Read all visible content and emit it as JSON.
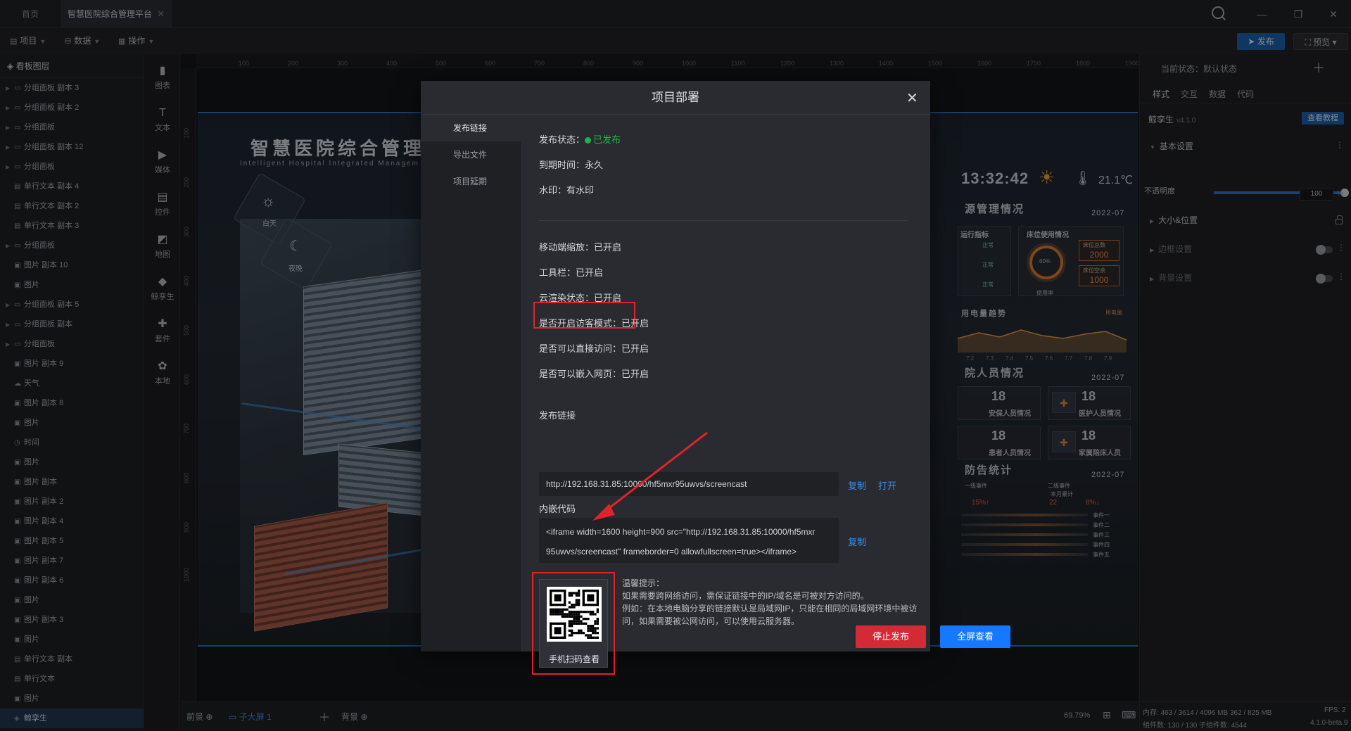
{
  "tabs": {
    "home": "首页",
    "active": "智慧医院综合管理平台"
  },
  "toolbar": {
    "menus": [
      "项目",
      "数据",
      "操作"
    ],
    "publish": "发布",
    "preview": "预览"
  },
  "layers": {
    "title": "看板图层",
    "items": [
      {
        "label": "分组面板 副本 3",
        "icon": "folder-icon",
        "group": true
      },
      {
        "label": "分组面板 副本 2",
        "icon": "folder-icon",
        "group": true
      },
      {
        "label": "分组面板",
        "icon": "folder-icon",
        "group": true
      },
      {
        "label": "分组面板 副本 12",
        "icon": "folder-icon",
        "group": true
      },
      {
        "label": "分组面板",
        "icon": "folder-icon",
        "group": true
      },
      {
        "label": "单行文本 副本 4",
        "icon": "text-icon",
        "group": false
      },
      {
        "label": "单行文本 副本 2",
        "icon": "text-icon",
        "group": false
      },
      {
        "label": "单行文本 副本 3",
        "icon": "text-icon",
        "group": false
      },
      {
        "label": "分组面板",
        "icon": "folder-icon",
        "group": true
      },
      {
        "label": "图片 副本 10",
        "icon": "image-icon",
        "group": false
      },
      {
        "label": "图片",
        "icon": "image-icon",
        "group": false
      },
      {
        "label": "分组面板 副本 5",
        "icon": "folder-icon",
        "group": true
      },
      {
        "label": "分组面板 副本",
        "icon": "folder-icon",
        "group": true
      },
      {
        "label": "分组面板",
        "icon": "folder-icon",
        "group": true
      },
      {
        "label": "图片 副本 9",
        "icon": "image-icon",
        "group": false
      },
      {
        "label": "天气",
        "icon": "weather-icon",
        "group": false
      },
      {
        "label": "图片 副本 8",
        "icon": "image-icon",
        "group": false
      },
      {
        "label": "图片",
        "icon": "image-icon",
        "group": false
      },
      {
        "label": "时间",
        "icon": "clock-icon",
        "group": false
      },
      {
        "label": "图片",
        "icon": "image-icon",
        "group": false
      },
      {
        "label": "图片 副本",
        "icon": "image-icon",
        "group": false
      },
      {
        "label": "图片 副本 2",
        "icon": "image-icon",
        "group": false
      },
      {
        "label": "图片 副本 4",
        "icon": "image-icon",
        "group": false
      },
      {
        "label": "图片 副本 5",
        "icon": "image-icon",
        "group": false
      },
      {
        "label": "图片 副本 7",
        "icon": "image-icon",
        "group": false
      },
      {
        "label": "图片 副本 6",
        "icon": "image-icon",
        "group": false
      },
      {
        "label": "图片",
        "icon": "image-icon",
        "group": false
      },
      {
        "label": "图片 副本 3",
        "icon": "image-icon",
        "group": false
      },
      {
        "label": "图片",
        "icon": "image-icon",
        "group": false
      },
      {
        "label": "单行文本 副本",
        "icon": "text-icon",
        "group": false
      },
      {
        "label": "单行文本",
        "icon": "text-icon",
        "group": false
      },
      {
        "label": "图片",
        "icon": "image-icon",
        "group": false
      },
      {
        "label": "鲸孪生",
        "icon": "twin-icon",
        "group": false,
        "selected": true
      }
    ]
  },
  "components": [
    {
      "label": "图表",
      "icon": "chart-icon"
    },
    {
      "label": "文本",
      "icon": "text-icon"
    },
    {
      "label": "媒体",
      "icon": "media-icon"
    },
    {
      "label": "控件",
      "icon": "widget-icon"
    },
    {
      "label": "地图",
      "icon": "map-icon"
    },
    {
      "label": "鲸孪生",
      "icon": "twin-icon"
    },
    {
      "label": "套件",
      "icon": "kit-icon"
    },
    {
      "label": "本地",
      "icon": "local-icon"
    }
  ],
  "ruler": {
    "h_ticks": [
      "100",
      "200",
      "300",
      "400",
      "500",
      "600",
      "700",
      "800",
      "900",
      "1000",
      "1100",
      "1200",
      "1300",
      "1400",
      "1500",
      "1600",
      "1700",
      "1800",
      "1900"
    ],
    "v_ticks": [
      "100",
      "200",
      "300",
      "400",
      "500",
      "600",
      "700",
      "800",
      "900",
      "1000"
    ]
  },
  "screen": {
    "title": "智慧医院综合管理",
    "subtitle": "Intelligent Hospital Integrated Managem",
    "day": "白天",
    "night": "夜晚",
    "time": "13:32:42",
    "temp": "21.1℃",
    "panel1": "源管理情况",
    "panel1_date": "2022-07",
    "bed_title": "床位使用情况",
    "bed_total_label": "床位总数",
    "bed_total": "2000",
    "bed_empty_label": "床位空余",
    "bed_empty": "1000",
    "bed_usage": "使用率",
    "ring_pct": "60%",
    "trend_title": "用电量趋势",
    "trend_legend": "用电量",
    "x_ticks": [
      "7.2",
      "7.3",
      "7.4",
      "7.5",
      "7.6",
      "7.7",
      "7.8",
      "7.9"
    ],
    "left_list_title": "运行指标",
    "status_ok": "正常",
    "panel2": "院人员情况",
    "panel2_date": "2022-07",
    "staff": [
      {
        "num": "18",
        "cap": "安保人员情况"
      },
      {
        "num": "18",
        "cap": "医护人员情况"
      },
      {
        "num": "18",
        "cap": "患者人员情况"
      },
      {
        "num": "18",
        "cap": "家属陪床人员"
      }
    ],
    "panel3": "防告统计",
    "panel3_date": "2022-07",
    "ev_left_title": "一级事件",
    "ev_left_pct": "15%↑",
    "ev_right_title": "二级事件",
    "ev_right_sub": "本月累计",
    "ev_right_num": "22",
    "ev_right_pct": "8%↓",
    "events": [
      "事件一",
      "事件二",
      "事件三",
      "事件四",
      "事件五"
    ]
  },
  "right": {
    "state": "当前状态：默认状态",
    "tabs": [
      "样式",
      "交互",
      "数据",
      "代码"
    ],
    "name": "鲸孪生",
    "version": "v4.1.0",
    "tutorial": "查看教程",
    "basic": "基本设置",
    "opacity_label": "不透明度",
    "opacity_value": "100",
    "opacity_unit": "%",
    "opacity_level": 1.0,
    "size_pos": "大小&位置",
    "border": "边框设置",
    "background": "背景设置"
  },
  "bottom": {
    "front": "前景",
    "sub_screen": "子大屏 1",
    "background": "背景",
    "zoom": "69.79%"
  },
  "stats": {
    "memory": "内存: 463 / 3614 / 4096 MB  362 / 825 MB",
    "fps": "FPS: 2",
    "components": "组件数: 130 / 130  子组件数: 4544",
    "version": "4.1.0-beta.9"
  },
  "modal": {
    "title": "项目部署",
    "nav": [
      "发布链接",
      "导出文件",
      "项目延期"
    ],
    "publish_status_label": "发布状态：",
    "publish_status_value": "已发布",
    "expire": "到期时间：永久",
    "watermark": "水印：有水印",
    "mobile_zoom": "移动端缩放：已开启",
    "toolbar": "工具栏：已开启",
    "cloud_render": "云渲染状态：已开启",
    "visitor_mode": "是否开启访客模式：已开启",
    "direct_access": "是否可以直接访问：已开启",
    "embed": "是否可以嵌入网页：已开启",
    "link_label": "发布链接",
    "link_url": "http://192.168.31.85:10000/hf5mxr95uwvs/screencast",
    "copy": "复制",
    "open": "打开",
    "embed_label": "内嵌代码",
    "embed_line1": "<iframe width=1600 height=900 src=\"http://192.168.31.85:10000/hf5mxr",
    "embed_line2": "95uwvs/screencast\" frameborder=0 allowfullscreen=true></iframe>",
    "qr_caption": "手机扫码查看",
    "tip_title": "温馨提示：",
    "tip_1": "如果需要跨网络访问，需保证链接中的IP/域名是可被对方访问的。",
    "tip_2": "例如：在本地电脑分享的链接默认是局域网IP，只能在相同的局域网环境中被访问，如果需要被公网访问，可以使用云服务器。",
    "stop": "停止发布",
    "fullscreen": "全屏查看"
  },
  "colors": {
    "accent": "#1677ff",
    "danger": "#d42a36",
    "success": "#27b24e",
    "highlight": "#e0232a"
  }
}
